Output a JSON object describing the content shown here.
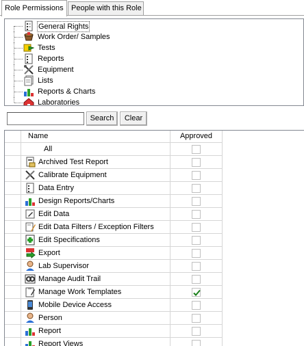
{
  "tabs": [
    {
      "label": "Role Permissions",
      "active": true
    },
    {
      "label": "People with this Role",
      "active": false
    }
  ],
  "tree": {
    "items": [
      {
        "label": "General Rights",
        "icon": "general-rights-icon",
        "selected": true
      },
      {
        "label": "Work Order/ Samples",
        "icon": "work-order-samples-icon",
        "selected": false
      },
      {
        "label": "Tests",
        "icon": "tests-icon",
        "selected": false
      },
      {
        "label": "Reports",
        "icon": "reports-icon",
        "selected": false
      },
      {
        "label": "Equipment",
        "icon": "equipment-icon",
        "selected": false
      },
      {
        "label": "Lists",
        "icon": "lists-icon",
        "selected": false
      },
      {
        "label": "Reports & Charts",
        "icon": "reports-charts-icon",
        "selected": false
      },
      {
        "label": "Laboratories",
        "icon": "laboratories-icon",
        "selected": false
      }
    ]
  },
  "search": {
    "value": "",
    "search_label": "Search",
    "clear_label": "Clear"
  },
  "grid": {
    "columns": {
      "name": "Name",
      "approved": "Approved"
    },
    "rows": [
      {
        "name": "All",
        "icon": "",
        "approved": false
      },
      {
        "name": "Archived Test Report",
        "icon": "archived-report-icon",
        "approved": false
      },
      {
        "name": "Calibrate Equipment",
        "icon": "calibrate-equipment-icon",
        "approved": false
      },
      {
        "name": "Data Entry",
        "icon": "data-entry-icon",
        "approved": false
      },
      {
        "name": "Design Reports/Charts",
        "icon": "design-charts-icon",
        "approved": false
      },
      {
        "name": "Edit Data",
        "icon": "edit-data-icon",
        "approved": false
      },
      {
        "name": "Edit Data Filters / Exception Filters",
        "icon": "edit-filters-icon",
        "approved": false
      },
      {
        "name": "Edit Specifications",
        "icon": "edit-specifications-icon",
        "approved": false
      },
      {
        "name": "Export",
        "icon": "export-pdf-icon",
        "approved": false
      },
      {
        "name": "Lab Supervisor",
        "icon": "lab-supervisor-icon",
        "approved": false
      },
      {
        "name": "Manage Audit Trail",
        "icon": "audit-trail-icon",
        "approved": false
      },
      {
        "name": "Manage Work Templates",
        "icon": "work-templates-icon",
        "approved": true
      },
      {
        "name": "Mobile Device Access",
        "icon": "mobile-device-icon",
        "approved": false
      },
      {
        "name": "Person",
        "icon": "person-icon",
        "approved": false
      },
      {
        "name": "Report",
        "icon": "report-icon",
        "approved": false
      },
      {
        "name": "Report Views",
        "icon": "report-views-icon",
        "approved": false
      }
    ]
  }
}
